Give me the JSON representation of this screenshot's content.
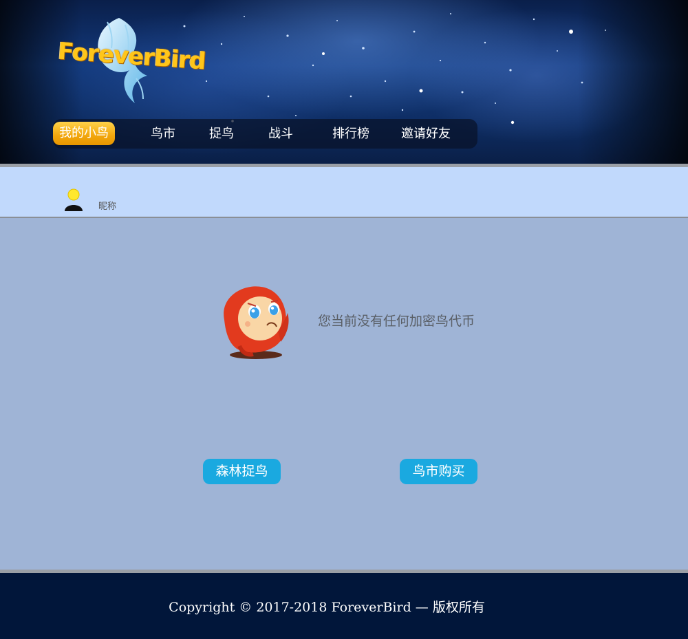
{
  "brand": {
    "logo_text": "ForeverBird"
  },
  "nav": {
    "items": [
      {
        "label": "我的小鸟",
        "active": true
      },
      {
        "label": "鸟市",
        "active": false
      },
      {
        "label": "捉鸟",
        "active": false
      },
      {
        "label": "战斗",
        "active": false
      },
      {
        "label": "排行榜",
        "active": false
      },
      {
        "label": "邀请好友",
        "active": false
      }
    ]
  },
  "profile": {
    "nickname": "昵称"
  },
  "main": {
    "empty_message": "您当前没有任何加密鸟代币",
    "buttons": {
      "forest_catch": "森林捉鸟",
      "market_buy": "鸟市购买"
    }
  },
  "footer": {
    "copyright": "Copyright © 2017-2018 ForeverBird — 版权所有"
  },
  "colors": {
    "nav_active": "#f2a60c",
    "button": "#1aa9e0",
    "profile_bar": "#c1d9fc",
    "main_bg": "#9fb4d6",
    "footer_bg": "#01163a"
  }
}
